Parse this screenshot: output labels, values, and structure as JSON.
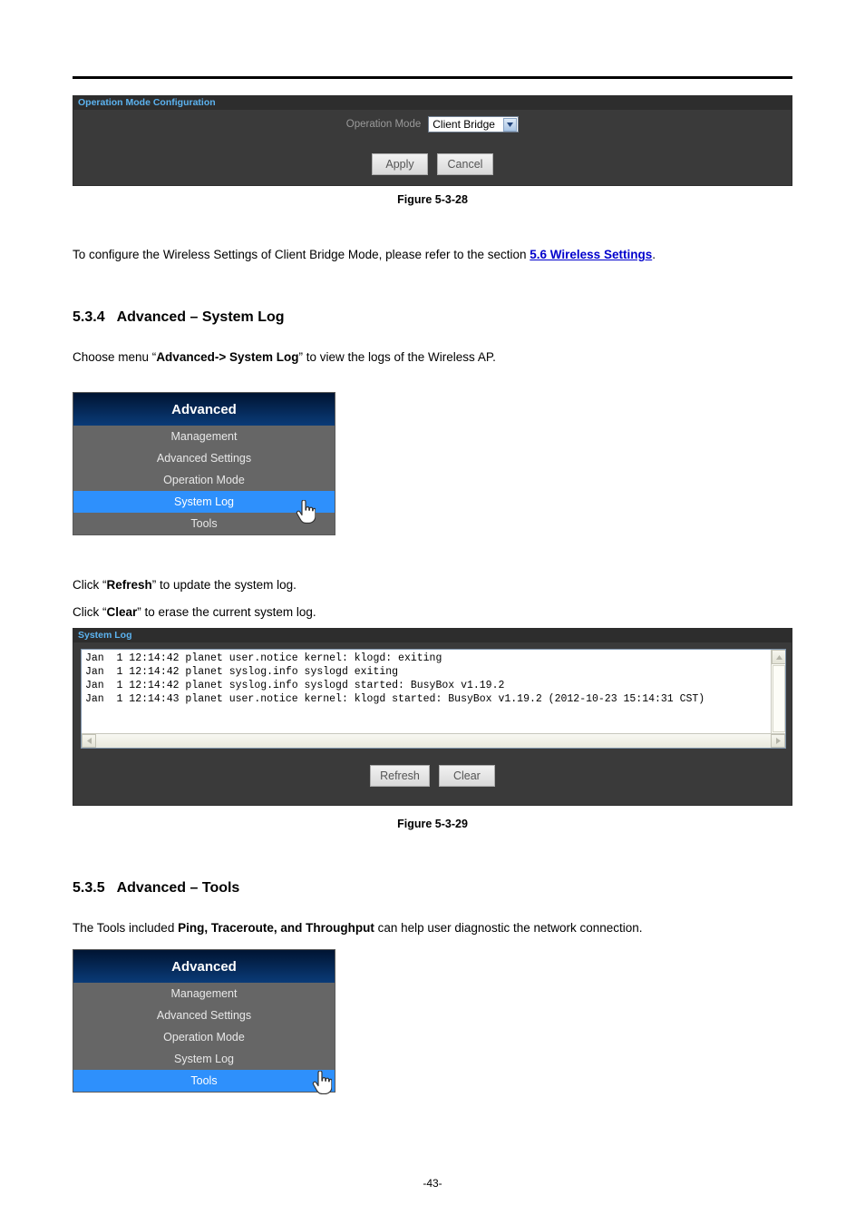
{
  "document": {
    "page_number": "-43-"
  },
  "figure_28": {
    "panel_title": "Operation Mode Configuration",
    "field_label": "Operation Mode",
    "select_value": "Client Bridge",
    "select_options": [
      "Client Bridge"
    ],
    "apply_label": "Apply",
    "cancel_label": "Cancel",
    "caption": "Figure 5-3-28"
  },
  "paragraph_refer": {
    "before": "To configure the Wireless Settings of Client Bridge Mode, please refer to the section ",
    "link": "5.6 Wireless Settings",
    "after": "."
  },
  "section_534": {
    "number": "5.3.4",
    "title": "Advanced – System Log",
    "intro_before": "Choose menu “",
    "intro_bold": "Advanced-> System Log",
    "intro_after": "” to view the logs of the Wireless AP."
  },
  "nav_menu_1": {
    "header": "Advanced",
    "items": [
      {
        "label": "Management",
        "selected": false
      },
      {
        "label": "Advanced Settings",
        "selected": false
      },
      {
        "label": "Operation Mode",
        "selected": false
      },
      {
        "label": "System Log",
        "selected": true
      },
      {
        "label": "Tools",
        "selected": false
      }
    ]
  },
  "instructions": {
    "refresh_before": "Click “",
    "refresh_bold": "Refresh",
    "refresh_after": "” to update the system log.",
    "clear_before": "Click “",
    "clear_bold": "Clear",
    "clear_after": "” to erase the current system log."
  },
  "figure_29": {
    "panel_title": "System Log",
    "log_lines": [
      "Jan  1 12:14:42 planet user.notice kernel: klogd: exiting",
      "Jan  1 12:14:42 planet syslog.info syslogd exiting",
      "Jan  1 12:14:42 planet syslog.info syslogd started: BusyBox v1.19.2",
      "Jan  1 12:14:43 planet user.notice kernel: klogd started: BusyBox v1.19.2 (2012-10-23 15:14:31 CST)"
    ],
    "refresh_label": "Refresh",
    "clear_label": "Clear",
    "caption": "Figure 5-3-29"
  },
  "section_535": {
    "number": "5.3.5",
    "title": "Advanced – Tools",
    "intro_before": "The Tools included ",
    "intro_bold": "Ping, Traceroute, and Throughput",
    "intro_after": " can help user diagnostic the network connection."
  },
  "nav_menu_2": {
    "header": "Advanced",
    "items": [
      {
        "label": "Management",
        "selected": false
      },
      {
        "label": "Advanced Settings",
        "selected": false
      },
      {
        "label": "Operation Mode",
        "selected": false
      },
      {
        "label": "System Log",
        "selected": false
      },
      {
        "label": "Tools",
        "selected": true
      }
    ]
  },
  "colors": {
    "panel_bg": "#3a3a3a",
    "panel_title_bg": "#2d2d2d",
    "panel_title_text": "#5cb3f0",
    "nav_selected": "#2e90fc",
    "nav_bg": "#666666",
    "link": "#0000cc"
  },
  "icons": {
    "select_chevron": "▼",
    "scroll_up": "▲",
    "scroll_left": "◀",
    "scroll_right": "▶"
  }
}
